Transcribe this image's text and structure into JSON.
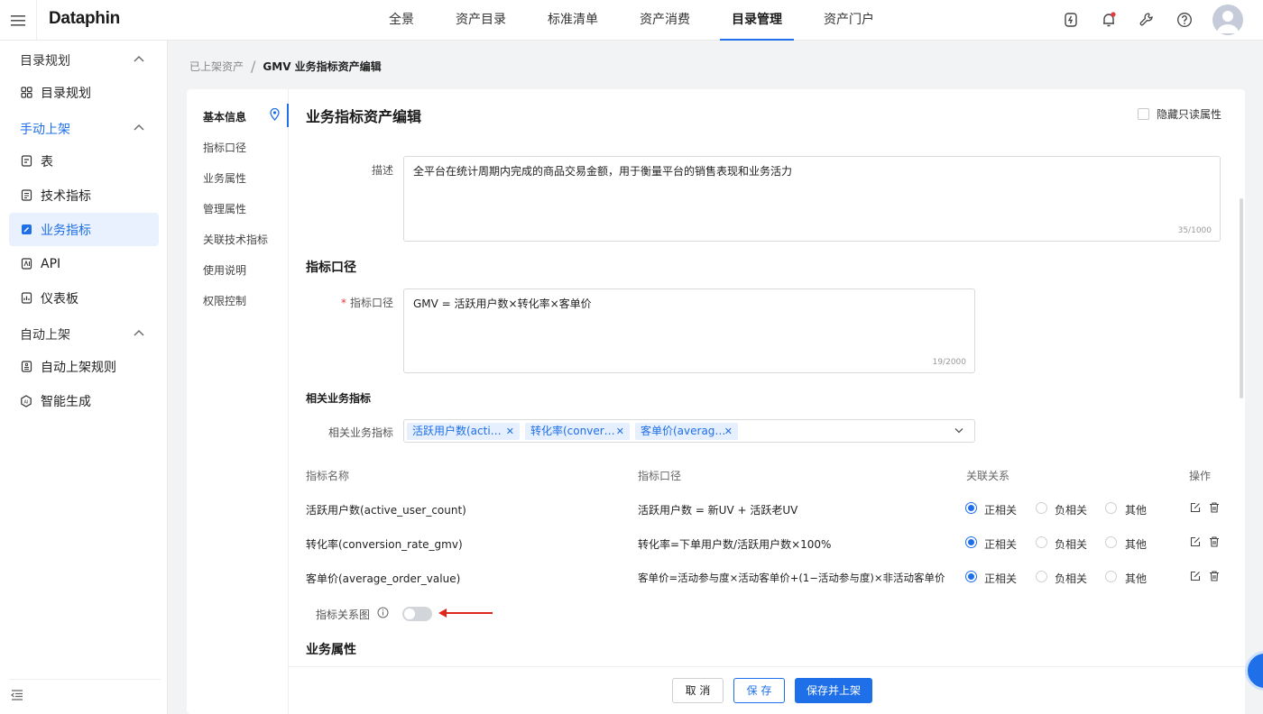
{
  "app": {
    "logo": "Dataphin"
  },
  "nav": {
    "items": [
      "全景",
      "资产目录",
      "标准清单",
      "资产消费",
      "目录管理",
      "资产门户"
    ],
    "active_index": 4
  },
  "sidebar": {
    "groups": [
      {
        "label": "目录规划",
        "items": [
          {
            "label": "目录规划",
            "icon": "grid-icon"
          }
        ]
      },
      {
        "label": "手动上架",
        "items": [
          {
            "label": "表",
            "icon": "table-icon"
          },
          {
            "label": "技术指标",
            "icon": "doc-icon"
          },
          {
            "label": "业务指标",
            "icon": "edit-doc-icon",
            "active": true
          },
          {
            "label": "API",
            "icon": "api-icon"
          },
          {
            "label": "仪表板",
            "icon": "dashboard-icon"
          }
        ]
      },
      {
        "label": "自动上架",
        "items": [
          {
            "label": "自动上架规则",
            "icon": "rule-icon"
          },
          {
            "label": "智能生成",
            "icon": "ai-icon"
          }
        ]
      }
    ]
  },
  "breadcrumb": {
    "parent": "已上架资产",
    "separator": "/",
    "current": "GMV 业务指标资产编辑"
  },
  "anchor": {
    "items": [
      "基本信息",
      "指标口径",
      "业务属性",
      "管理属性",
      "关联技术指标",
      "使用说明",
      "权限控制"
    ],
    "active_index": 0
  },
  "form": {
    "title": "业务指标资产编辑",
    "hide_readonly_label": "隐藏只读属性",
    "description": {
      "label": "描述",
      "value": "全平台在统计周期内完成的商品交易金额，用于衡量平台的销售表现和业务活力",
      "counter": "35/1000"
    },
    "caliber_section": "指标口径",
    "caliber": {
      "required_mark": "*",
      "label": "指标口径",
      "value": "GMV = 活跃用户数×转化率×客单价",
      "counter": "19/2000"
    },
    "related_section": "相关业务指标",
    "related": {
      "label": "相关业务指标",
      "tags": [
        "活跃用户数(acti…",
        "转化率(conver…",
        "客单价(averag…"
      ]
    },
    "table": {
      "headers": [
        "指标名称",
        "指标口径",
        "关联关系",
        "操作"
      ],
      "relation_options": [
        "正相关",
        "负相关",
        "其他"
      ],
      "rows": [
        {
          "name": "活跃用户数(active_user_count)",
          "caliber": "活跃用户数 = 新UV + 活跃老UV",
          "relation_index": 0
        },
        {
          "name": "转化率(conversion_rate_gmv)",
          "caliber": "转化率=下单用户数/活跃用户数×100%",
          "relation_index": 0
        },
        {
          "name": "客单价(average_order_value)",
          "caliber": "客单价=活动参与度×活动客单价+(1−活动参与度)×非活动客单价",
          "relation_index": 0
        }
      ]
    },
    "relation_graph": {
      "label": "指标关系图",
      "enabled": false
    },
    "biz_section": "业务属性"
  },
  "footer": {
    "cancel": "取 消",
    "save": "保 存",
    "save_publish": "保存并上架"
  },
  "colors": {
    "accent": "#1e6fe8",
    "arrow": "#e0251b"
  }
}
